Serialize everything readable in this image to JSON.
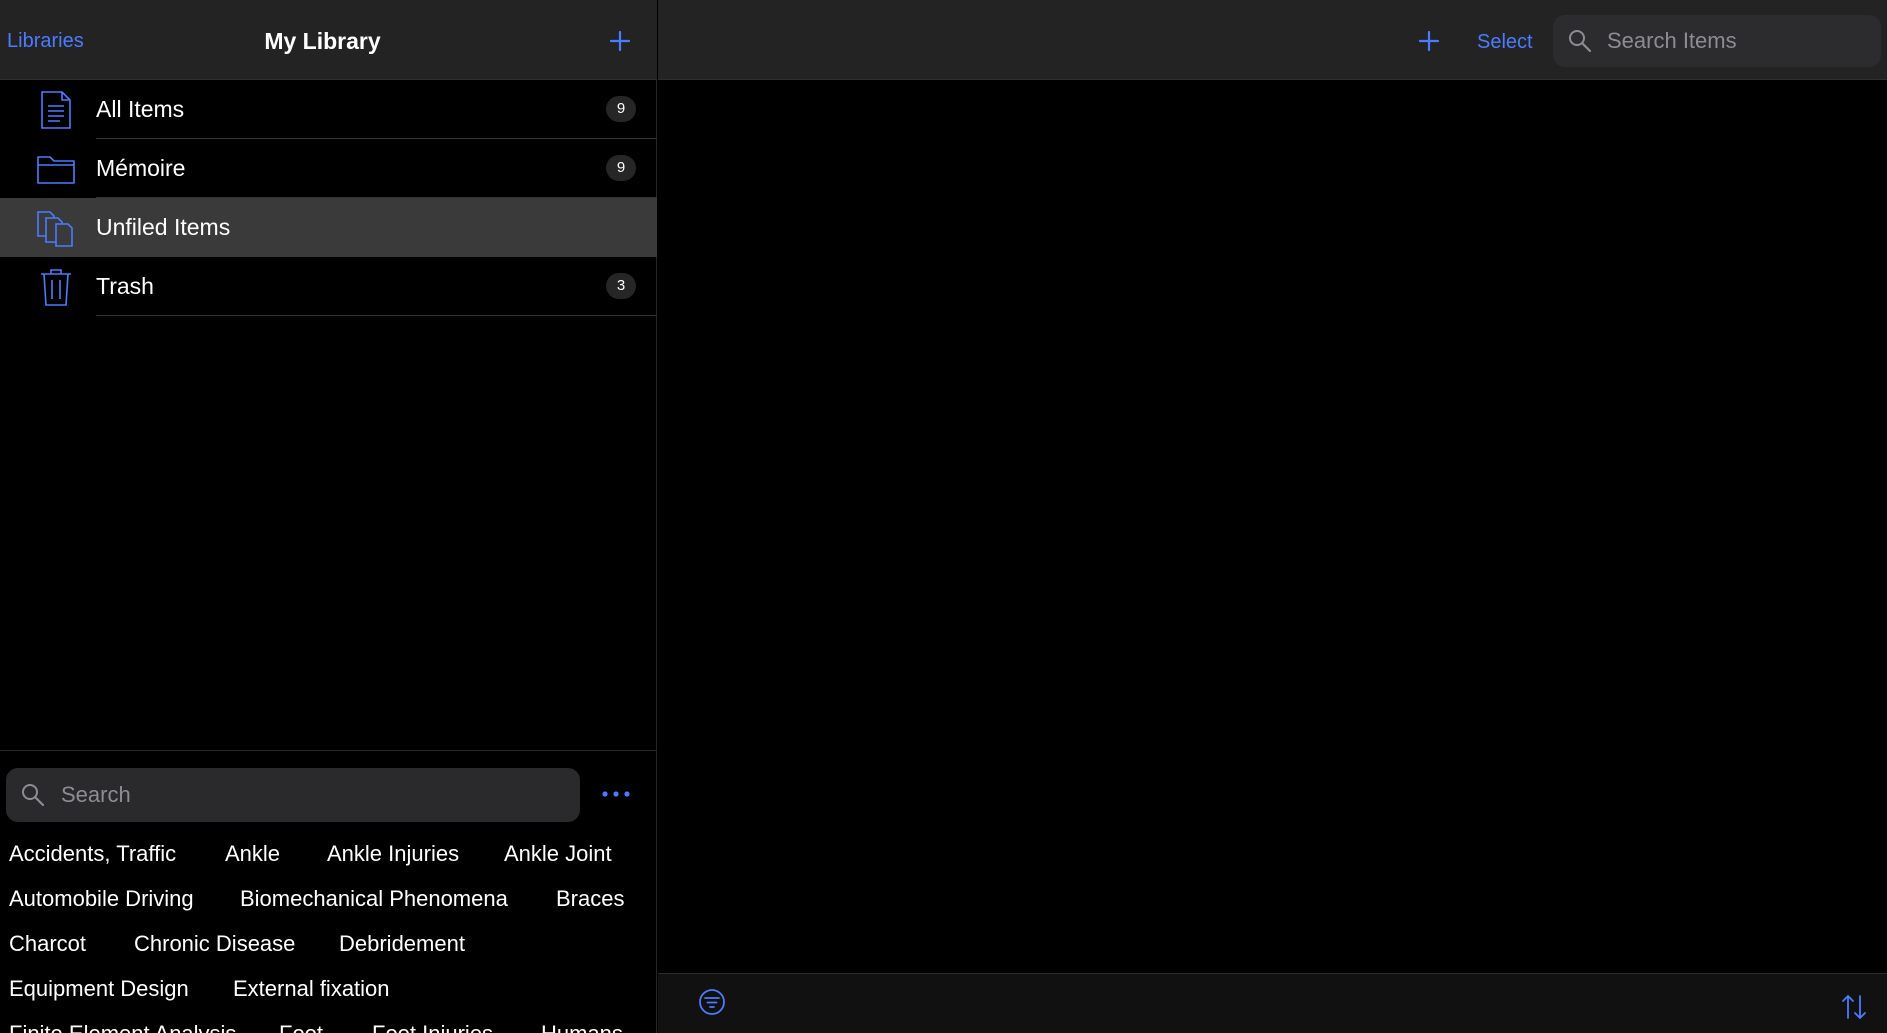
{
  "sidebar": {
    "back_label": "Libraries",
    "title": "My Library",
    "add_icon": "plus-icon",
    "collections": [
      {
        "label": "All Items",
        "count": "9",
        "icon": "document-icon",
        "selected": false
      },
      {
        "label": "Mémoire",
        "count": "9",
        "icon": "folder-icon",
        "selected": false
      },
      {
        "label": "Unfiled Items",
        "count": "",
        "icon": "unfiled-documents-icon",
        "selected": true
      },
      {
        "label": "Trash",
        "count": "3",
        "icon": "trash-icon",
        "selected": false
      }
    ]
  },
  "tags": {
    "search_placeholder": "Search",
    "more_icon": "ellipsis-icon",
    "rows": [
      [
        "Accidents, Traffic",
        "Ankle",
        "Ankle Injuries",
        "Ankle Joint"
      ],
      [
        "Automobile Driving",
        "Biomechanical Phenomena",
        "Braces"
      ],
      [
        "Charcot",
        "Chronic Disease",
        "Debridement"
      ],
      [
        "Equipment Design",
        "External fixation"
      ],
      [
        "Finite Element Analysis",
        "Foot",
        "Foot Injuries",
        "Humans"
      ]
    ]
  },
  "main": {
    "add_icon": "plus-icon",
    "select_label": "Select",
    "search_placeholder": "Search Items",
    "filter_icon": "filter-icon",
    "sort_icon": "sort-icon"
  },
  "colors": {
    "accent": "#4a7cff",
    "header_bg": "#232323",
    "selected_row": "#3a3a3a",
    "background": "#000000"
  }
}
